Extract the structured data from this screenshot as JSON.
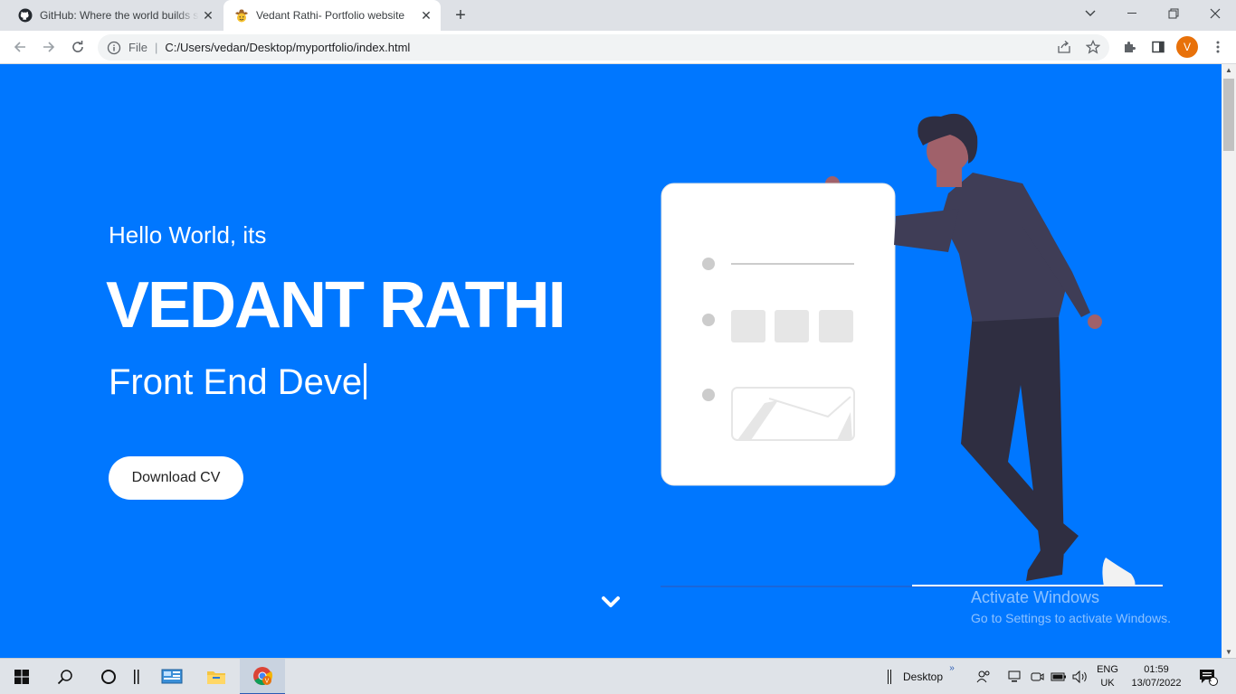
{
  "browser": {
    "tabs": [
      {
        "title": "GitHub: Where the world builds software",
        "icon": "github-icon",
        "active": false
      },
      {
        "title": "Vedant Rathi- Portfolio website",
        "icon": "cowboy-emoji-icon",
        "active": true
      }
    ],
    "omnibox": {
      "scheme_label": "File",
      "url": "C:/Users/vedan/Desktop/myportfolio/index.html"
    },
    "profile_initial": "V",
    "profile_color": "#e8710a"
  },
  "hero": {
    "greeting": "Hello World, its",
    "name": "VEDANT RATHI",
    "role_typed": "Front End Deve",
    "cta_label": "Download CV",
    "background_color": "#0077ff"
  },
  "watermark": {
    "line1": "Activate Windows",
    "line2": "Go to Settings to activate Windows."
  },
  "taskbar": {
    "desktop_label": "Desktop",
    "language": "ENG",
    "region": "UK",
    "time": "01:59",
    "date": "13/07/2022",
    "notification_count": "1"
  }
}
